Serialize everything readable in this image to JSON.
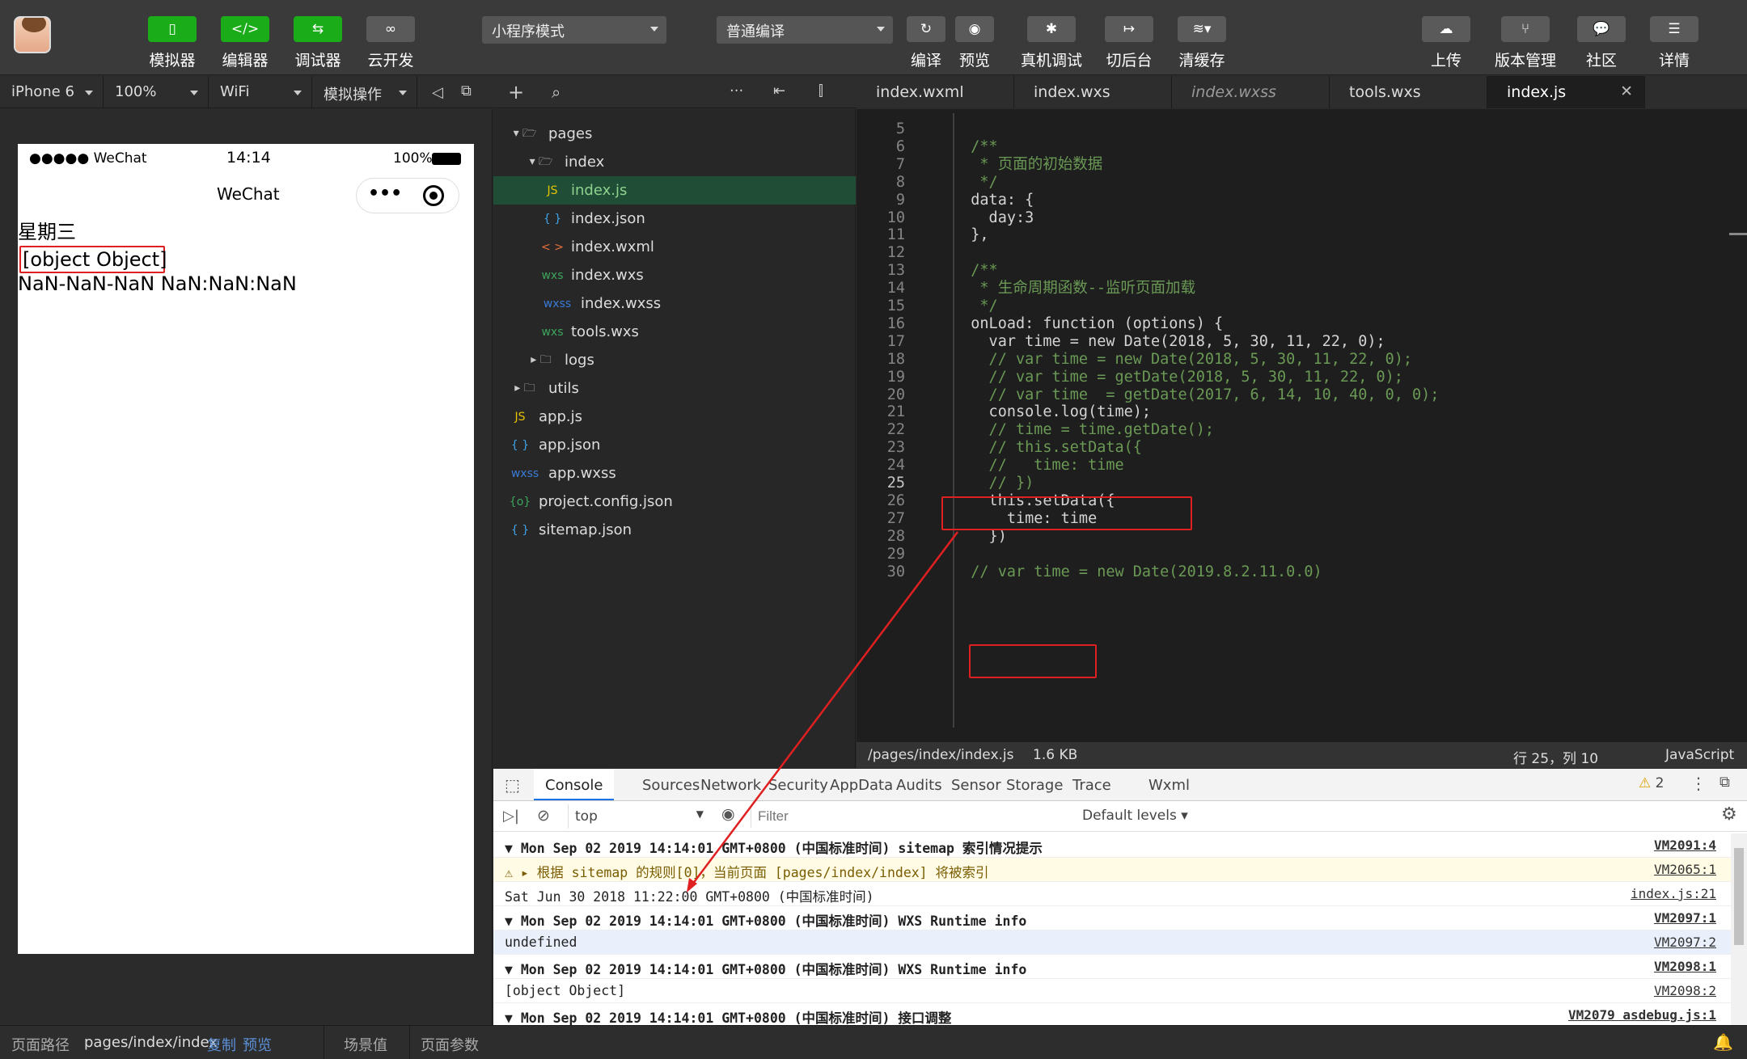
{
  "toolbar": {
    "buttons": [
      {
        "label": "模拟器",
        "icon": "phone-icon"
      },
      {
        "label": "编辑器",
        "icon": "code-icon"
      },
      {
        "label": "调试器",
        "icon": "sliders-icon"
      },
      {
        "label": "云开发",
        "icon": "cloud-link-icon"
      }
    ],
    "mode_select": "小程序模式",
    "compile_select": "普通编译",
    "actions": [
      "编译",
      "预览",
      "真机调试",
      "切后台",
      "清缓存"
    ],
    "right_actions": [
      "上传",
      "版本管理",
      "社区",
      "详情"
    ]
  },
  "sim_bar": {
    "device": "iPhone 6",
    "zoom": "100%",
    "network": "WiFi",
    "ops": "模拟操作"
  },
  "phone": {
    "carrier": "●●●●● WeChat",
    "time": "14:14",
    "battery": "100%",
    "nav_title": "WeChat",
    "line1": "星期三",
    "line2": "[object Object]",
    "line3": "NaN-NaN-NaN NaN:NaN:NaN"
  },
  "tree": [
    {
      "label": "pages",
      "icon": "▾ 🗁",
      "depth": 0
    },
    {
      "label": "index",
      "icon": "▾ 🗁",
      "depth": 1
    },
    {
      "label": "index.js",
      "icon": "JS",
      "depth": 2,
      "selected": true
    },
    {
      "label": "index.json",
      "icon": "{ }",
      "depth": 2
    },
    {
      "label": "index.wxml",
      "icon": "< >",
      "depth": 2
    },
    {
      "label": "index.wxs",
      "icon": "wxs",
      "depth": 2
    },
    {
      "label": "index.wxss",
      "icon": "wxss",
      "depth": 2
    },
    {
      "label": "tools.wxs",
      "icon": "wxs",
      "depth": 2
    },
    {
      "label": "logs",
      "icon": "▸ 🗀",
      "depth": 1
    },
    {
      "label": "utils",
      "icon": "▸ 🗀",
      "depth": 0
    },
    {
      "label": "app.js",
      "icon": "JS",
      "depth": 0
    },
    {
      "label": "app.json",
      "icon": "{ }",
      "depth": 0
    },
    {
      "label": "app.wxss",
      "icon": "wxss",
      "depth": 0
    },
    {
      "label": "project.config.json",
      "icon": "{o}",
      "depth": 0
    },
    {
      "label": "sitemap.json",
      "icon": "{ }",
      "depth": 0
    }
  ],
  "editor_tabs": [
    "index.wxml",
    "index.wxs",
    "index.wxss",
    "tools.wxs",
    "index.js"
  ],
  "code": [
    {
      "n": "5",
      "t": ""
    },
    {
      "n": "6",
      "t": "  /**"
    },
    {
      "n": "7",
      "t": "   * 页面的初始数据"
    },
    {
      "n": "8",
      "t": "   */"
    },
    {
      "n": "9",
      "t": "  data: {"
    },
    {
      "n": "10",
      "t": "    day:3"
    },
    {
      "n": "11",
      "t": "  },"
    },
    {
      "n": "12",
      "t": ""
    },
    {
      "n": "13",
      "t": "  /**"
    },
    {
      "n": "14",
      "t": "   * 生命周期函数--监听页面加载"
    },
    {
      "n": "15",
      "t": "   */"
    },
    {
      "n": "16",
      "t": "  onLoad: function (options) {"
    },
    {
      "n": "17",
      "t": "    var time = new Date(2018, 5, 30, 11, 22, 0);"
    },
    {
      "n": "18",
      "t": "    // var time = new Date(2018, 5, 30, 11, 22, 0);"
    },
    {
      "n": "19",
      "t": "    // var time = getDate(2018, 5, 30, 11, 22, 0);"
    },
    {
      "n": "20",
      "t": "    // var time  = getDate(2017, 6, 14, 10, 40, 0, 0);"
    },
    {
      "n": "21",
      "t": "    console.log(time);"
    },
    {
      "n": "22",
      "t": "    // time = time.getDate();"
    },
    {
      "n": "23",
      "t": "    // this.setData({"
    },
    {
      "n": "24",
      "t": "    //   time: time"
    },
    {
      "n": "25",
      "t": "    // })"
    },
    {
      "n": "26",
      "t": "    this.setData({"
    },
    {
      "n": "27",
      "t": "      time: time"
    },
    {
      "n": "28",
      "t": "    })"
    },
    {
      "n": "29",
      "t": ""
    },
    {
      "n": "30",
      "t": "  // var time = new Date(2019.8.2.11.0.0)"
    }
  ],
  "editor_status": {
    "path": "/pages/index/index.js",
    "size": "1.6 KB",
    "cursor": "行 25，列 10",
    "lang": "JavaScript"
  },
  "devtools": {
    "tabs": [
      "Console",
      "Sources",
      "Network",
      "Security",
      "AppData",
      "Audits",
      "Sensor",
      "Storage",
      "Trace",
      "Wxml"
    ],
    "warn_count": "2",
    "context": "top",
    "filter_placeholder": "Filter",
    "levels": "Default levels",
    "rows": [
      {
        "text": "▼ Mon Sep 02 2019 14:14:01 GMT+0800 (中国标准时间) sitemap 索引情况提示",
        "src": "VM2091:4",
        "kind": "group"
      },
      {
        "text": "⚠ ▸ 根据 sitemap 的规则[0]，当前页面 [pages/index/index] 将被索引",
        "src": "VM2065:1",
        "kind": "warn"
      },
      {
        "text": "  Sat Jun 30 2018 11:22:00 GMT+0800 (中国标准时间)",
        "src": "index.js:21",
        "kind": "log"
      },
      {
        "text": "▼ Mon Sep 02 2019 14:14:01 GMT+0800 (中国标准时间) WXS Runtime info",
        "src": "VM2097:1",
        "kind": "group"
      },
      {
        "text": "    undefined",
        "src": "VM2097:2",
        "kind": "child"
      },
      {
        "text": "▼ Mon Sep 02 2019 14:14:01 GMT+0800 (中国标准时间) WXS Runtime info",
        "src": "VM2098:1",
        "kind": "group"
      },
      {
        "text": "    [object Object]",
        "src": "VM2098:2",
        "kind": "log"
      },
      {
        "text": "▼ Mon Sep 02 2019 14:14:01 GMT+0800 (中国标准时间) 接口调整",
        "src": "VM2079 asdebug.js:1",
        "kind": "group"
      }
    ]
  },
  "bottom": {
    "path_label": "页面路径",
    "path": "pages/index/index",
    "copy": "复制",
    "preview": "预览",
    "scene": "场景值",
    "params": "页面参数"
  }
}
